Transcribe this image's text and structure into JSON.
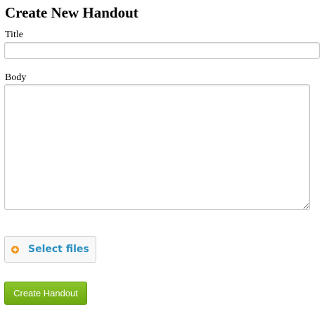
{
  "page": {
    "title": "Create New Handout"
  },
  "form": {
    "title_label": "Title",
    "title_value": "",
    "body_label": "Body",
    "body_value": "",
    "select_files_label": "Select files",
    "select_files_icon": "plus-circle-icon",
    "submit_label": "Create Handout"
  },
  "colors": {
    "select_files_text": "#2a8fc0",
    "select_files_icon": "#f0961e",
    "submit_background": "#7bb51d",
    "submit_text": "#ffffff"
  }
}
